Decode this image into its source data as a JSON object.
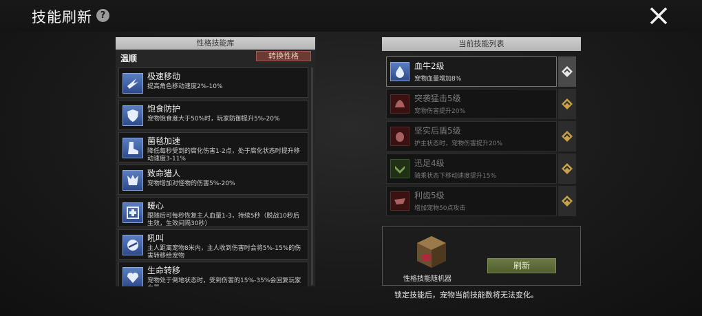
{
  "header": {
    "title": "技能刷新",
    "help": "?"
  },
  "trait_library": {
    "title": "性格技能库",
    "trait_name": "温顺",
    "switch_label": "转换性格",
    "skills": [
      {
        "name": "极速移动",
        "desc": "提高角色移动速度2%-10%",
        "icon": "speed-wing-icon"
      },
      {
        "name": "饱食防护",
        "desc": "宠物饱食度大于50%时，玩家防御提升5%-20%",
        "icon": "shield-icon"
      },
      {
        "name": "菌毯加速",
        "desc": "降低每秒受到的腐化伤害1-2点，处于腐化状态时提升移动速度3-11%",
        "icon": "boot-icon"
      },
      {
        "name": "致命猎人",
        "desc": "宠物增加对怪物的伤害5%-20%",
        "icon": "hunter-icon"
      },
      {
        "name": "暖心",
        "desc": "跟随后可每秒恢复主人血量1-3，持续5秒（脱战10秒后生效，生效间隔30秒）",
        "icon": "heal-cross-icon"
      },
      {
        "name": "吼叫",
        "desc": "主人距离宠物8米内，主人收到伤害时会将5%-15%的伤害转移给宠物",
        "icon": "roar-icon"
      },
      {
        "name": "生命转移",
        "desc": "宠物处于倒地状态时，受到伤害的15%-35%会回复玩家血量",
        "icon": "life-transfer-icon"
      }
    ]
  },
  "current_skills": {
    "title": "当前技能列表",
    "items": [
      {
        "name": "血牛2级",
        "desc": "宠物血量增加8%",
        "state": "active",
        "icon": "blood-drop-icon"
      },
      {
        "name": "突袭猛击5级",
        "desc": "宠物伤害提升20%",
        "state": "dim",
        "icon": "claw-icon"
      },
      {
        "name": "坚实后盾5级",
        "desc": "护主状态时，宠物伤害提升20%",
        "state": "dim",
        "icon": "beetle-icon"
      },
      {
        "name": "迅足4级",
        "desc": "骑乘状态下移动速度提升15%",
        "state": "dim-green",
        "icon": "swift-foot-icon"
      },
      {
        "name": "利齿5级",
        "desc": "增加宠物50点攻击",
        "state": "dim",
        "icon": "fang-icon"
      }
    ]
  },
  "randomizer": {
    "label": "性格技能随机器",
    "refresh_label": "刷新"
  },
  "lock_note": "锁定技能后，宠物当前技能数将无法变化。",
  "colors": {
    "accent_gold": "#c8a24a",
    "switch_red": "#6b3a32",
    "refresh_green": "#5d6b39"
  }
}
